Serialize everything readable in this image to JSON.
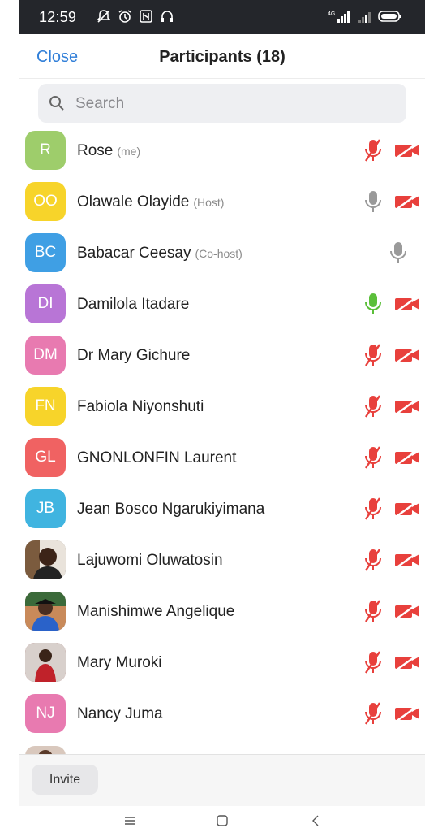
{
  "status_bar": {
    "time": "12:59",
    "signal_label": "4G",
    "icons": [
      "mute-notification-icon",
      "alarm-icon",
      "nfc-icon",
      "headset-icon",
      "signal-icon",
      "wifi-icon",
      "battery-icon"
    ]
  },
  "header": {
    "close_label": "Close",
    "title": "Participants (18)"
  },
  "search": {
    "placeholder": "Search",
    "value": ""
  },
  "participants": [
    {
      "initials": "R",
      "name": "Rose",
      "role": "(me)",
      "avatar_color": "#9ecd6b",
      "mic": "muted",
      "video": "off"
    },
    {
      "initials": "OO",
      "name": "Olawale Olayide",
      "role": "(Host)",
      "avatar_color": "#f7d42a",
      "mic": "on",
      "video": "off"
    },
    {
      "initials": "BC",
      "name": "Babacar Ceesay",
      "role": "(Co-host)",
      "avatar_color": "#3f9fe4",
      "mic": "on",
      "video": "none"
    },
    {
      "initials": "DI",
      "name": "Damilola Itadare",
      "role": "",
      "avatar_color": "#b875d6",
      "mic": "talking",
      "video": "off"
    },
    {
      "initials": "DM",
      "name": "Dr Mary Gichure",
      "role": "",
      "avatar_color": "#e87ab0",
      "mic": "muted",
      "video": "off"
    },
    {
      "initials": "FN",
      "name": "Fabiola Niyonshuti",
      "role": "",
      "avatar_color": "#f7d42a",
      "mic": "muted",
      "video": "off"
    },
    {
      "initials": "GL",
      "name": "GNONLONFIN Laurent",
      "role": "",
      "avatar_color": "#f06262",
      "mic": "muted",
      "video": "off"
    },
    {
      "initials": "JB",
      "name": "Jean Bosco Ngarukiyimana",
      "role": "",
      "avatar_color": "#40b4e0",
      "mic": "muted",
      "video": "off"
    },
    {
      "initials": "",
      "name": "Lajuwomi Oluwatosin",
      "role": "",
      "avatar_color": "#6b5a4a",
      "photo": "portrait-photo-man",
      "mic": "muted",
      "video": "off"
    },
    {
      "initials": "",
      "name": "Manishimwe Angelique",
      "role": "",
      "avatar_color": "#3e5e8e",
      "photo": "portrait-photo-graduate",
      "mic": "muted",
      "video": "off"
    },
    {
      "initials": "",
      "name": "Mary Muroki",
      "role": "",
      "avatar_color": "#8a3b3b",
      "photo": "portrait-photo-woman",
      "mic": "muted",
      "video": "off"
    },
    {
      "initials": "NJ",
      "name": "Nancy Juma",
      "role": "",
      "avatar_color": "#e87ab0",
      "mic": "muted",
      "video": "off"
    }
  ],
  "footer": {
    "invite_label": "Invite"
  },
  "colors": {
    "accent": "#2f7ed8",
    "muted_red": "#e8403c",
    "talking_green": "#5bbf3a",
    "mic_grey": "#9a9a9a"
  },
  "nav_bar": {
    "icons": [
      "menu-icon",
      "home-icon",
      "back-icon"
    ]
  }
}
